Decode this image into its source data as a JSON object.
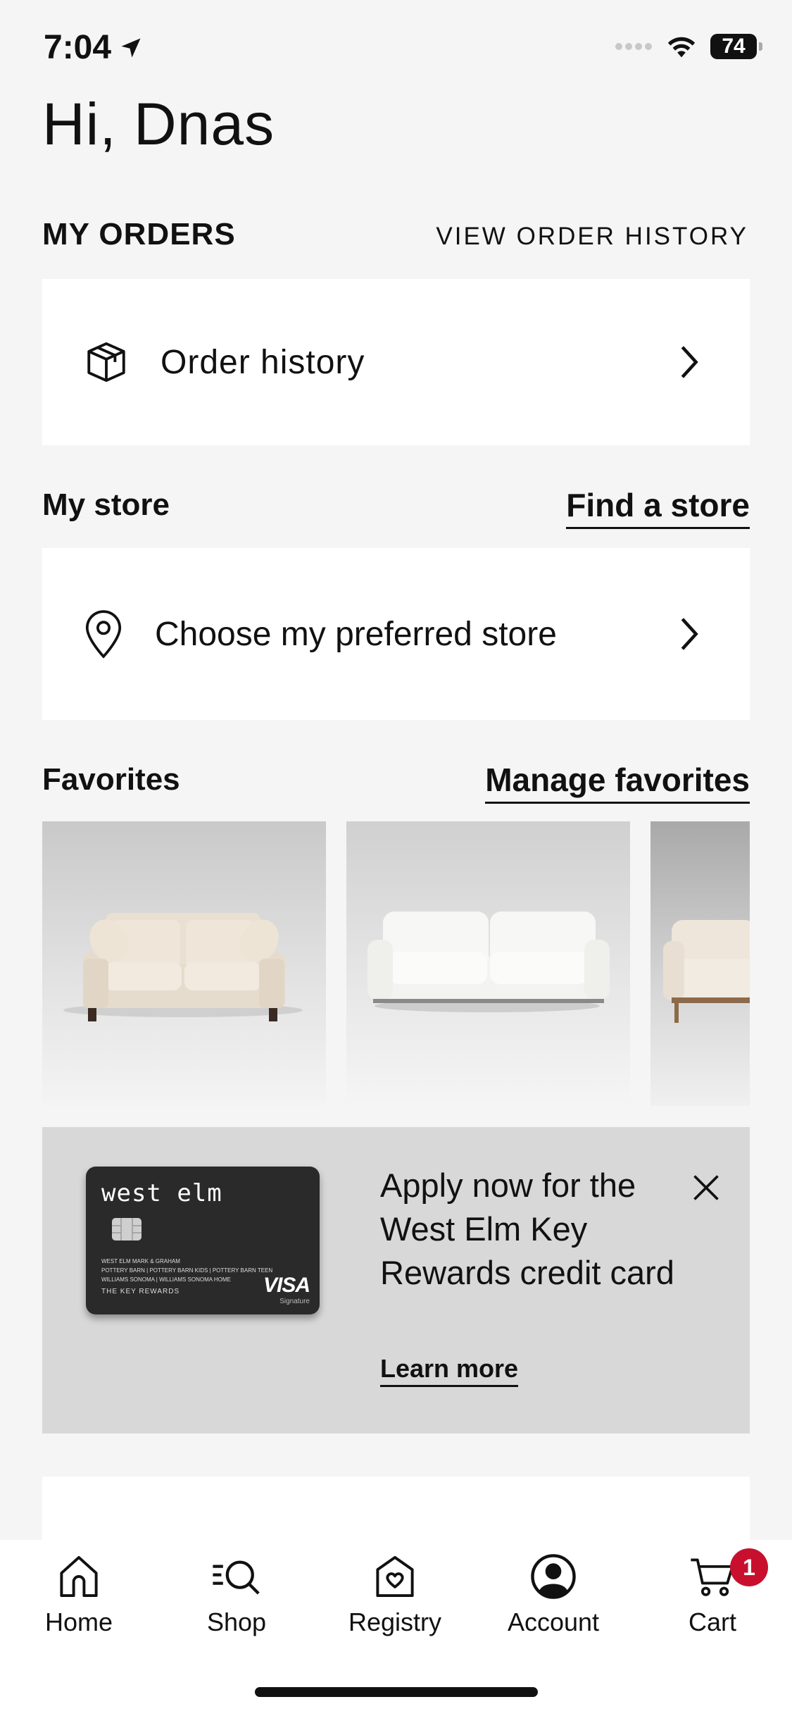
{
  "status_bar": {
    "time": "7:04",
    "battery": "74"
  },
  "greeting": "Hi, Dnas",
  "orders": {
    "title": "MY ORDERS",
    "view_history_link": "VIEW ORDER HISTORY",
    "card_label": "Order history"
  },
  "store": {
    "title": "My store",
    "find_link": "Find a store",
    "card_label": "Choose my preferred store"
  },
  "favorites": {
    "title": "Favorites",
    "manage_link": "Manage favorites",
    "items": [
      {
        "icon": "sofa-beige"
      },
      {
        "icon": "sofa-white"
      },
      {
        "icon": "sofa-partial"
      }
    ]
  },
  "promo": {
    "card_brand": "west elm",
    "card_fine_print_1": "WEST ELM   MARK & GRAHAM",
    "card_fine_print_2": "POTTERY BARN | POTTERY BARN KIDS | POTTERY BARN TEEN",
    "card_fine_print_3": "WILLIAMS SONOMA | WILLIAMS SONOMA HOME",
    "card_rewards": "THE KEY REWARDS",
    "card_network": "VISA",
    "card_network_sub": "Signature",
    "text": "Apply now for the West Elm Key Rewards credit card",
    "learn_more": "Learn more"
  },
  "tabbar": {
    "home": "Home",
    "shop": "Shop",
    "registry": "Registry",
    "account": "Account",
    "cart": "Cart",
    "cart_count": "1"
  },
  "colors": {
    "background": "#f5f5f5",
    "badge": "#c8102e",
    "promo_bg": "#d8d8d8"
  }
}
